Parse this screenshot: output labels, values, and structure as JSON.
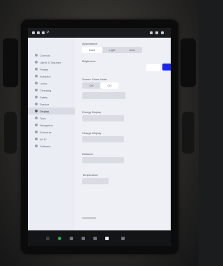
{
  "status_bar": {
    "left": "P",
    "right": ""
  },
  "sidebar": {
    "items": [
      {
        "label": "Controls",
        "active": false
      },
      {
        "label": "Lights & Displays",
        "active": false
      },
      {
        "label": "Pedals",
        "active": false
      },
      {
        "label": "Autopilot",
        "active": false
      },
      {
        "label": "Locks",
        "active": false
      },
      {
        "label": "Charging",
        "active": false
      },
      {
        "label": "Safety",
        "active": false
      },
      {
        "label": "Service",
        "active": false
      },
      {
        "label": "Display",
        "active": true
      },
      {
        "label": "Trips",
        "active": false
      },
      {
        "label": "Navigation",
        "active": false
      },
      {
        "label": "Schedule",
        "active": false
      },
      {
        "label": "Wi-Fi",
        "active": false
      },
      {
        "label": "Software",
        "active": false
      }
    ]
  },
  "content": {
    "appearance": {
      "label": "Appearance",
      "options": [
        "Dark",
        "Light",
        "Auto"
      ],
      "selected": 0
    },
    "brightness": {
      "label": "Brightness",
      "value": "",
      "btn1": "",
      "btn2": ""
    },
    "screen_clean": {
      "label": "Screen Clean Mode",
      "options": [
        "Off",
        "On"
      ],
      "selected": 1
    },
    "screen_btn": "",
    "energy": {
      "label": "Energy Display",
      "value": ""
    },
    "charge": {
      "label": "Charge Display",
      "value": ""
    },
    "distance": {
      "label": "Distance",
      "value": ""
    },
    "temperature": {
      "label": "Temperature",
      "value": ""
    },
    "scroll": {
      "label": ""
    }
  },
  "dock": {
    "temperature": ""
  },
  "colors": {
    "accent": "#1d28e6",
    "screen_bg": "#e6e9f1",
    "dock": "#131416"
  }
}
